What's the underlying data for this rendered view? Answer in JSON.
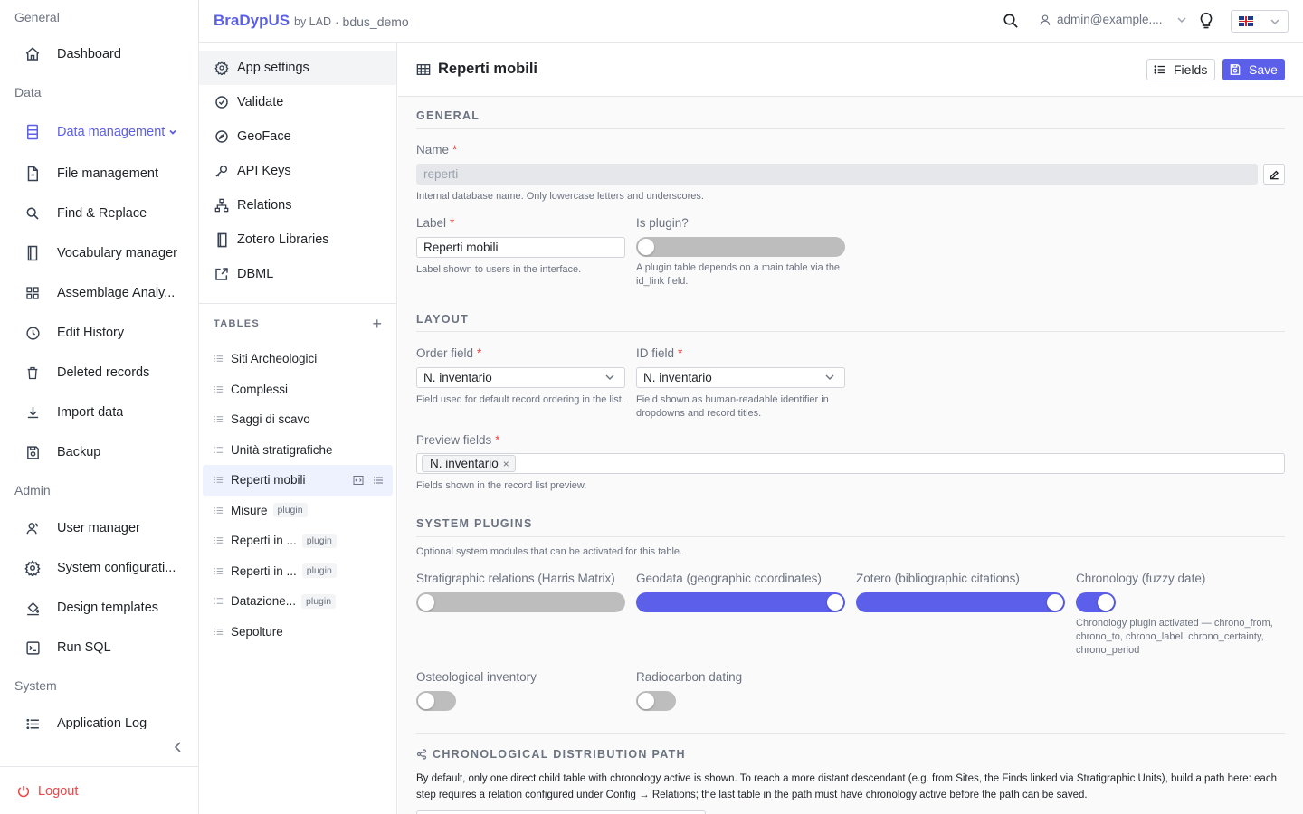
{
  "sidebar": {
    "groups": {
      "general": "General",
      "data": "Data",
      "admin": "Admin",
      "system": "System"
    },
    "items": {
      "dashboard": "Dashboard",
      "data_management": "Data management",
      "file_management": "File management",
      "find_replace": "Find & Replace",
      "vocabulary": "Vocabulary manager",
      "assemblage": "Assemblage Analy...",
      "edit_history": "Edit History",
      "deleted_records": "Deleted records",
      "import_data": "Import data",
      "backup": "Backup",
      "user_manager": "User manager",
      "system_config": "System configurati...",
      "design_templates": "Design templates",
      "run_sql": "Run SQL",
      "app_log": "Application Log"
    },
    "logout": "Logout"
  },
  "topbar": {
    "brand": "BraDypUS",
    "byline": "by LAD",
    "project": "· bdus_demo",
    "user": "admin@example....",
    "language_flag": "uk-flag-icon"
  },
  "settings_menu": {
    "items": [
      "App settings",
      "Validate",
      "GeoFace",
      "API Keys",
      "Relations",
      "Zotero Libraries",
      "DBML"
    ]
  },
  "tables": {
    "header": "TABLES",
    "rows": [
      {
        "name": "Siti Archeologici",
        "badge": ""
      },
      {
        "name": "Complessi",
        "badge": ""
      },
      {
        "name": "Saggi di scavo",
        "badge": ""
      },
      {
        "name": "Unità stratigrafiche",
        "badge": ""
      },
      {
        "name": "Reperti mobili",
        "badge": ""
      },
      {
        "name": "Misure",
        "badge": "plugin"
      },
      {
        "name": "Reperti in ...",
        "badge": "plugin"
      },
      {
        "name": "Reperti in ...",
        "badge": "plugin"
      },
      {
        "name": "Datazione...",
        "badge": "plugin"
      },
      {
        "name": "Sepolture",
        "badge": ""
      }
    ]
  },
  "main": {
    "title": "Reperti mobili",
    "fields_button": "Fields",
    "save_button": "Save",
    "general": {
      "title": "GENERAL",
      "name_label": "Name",
      "name_value": "reperti",
      "name_help": "Internal database name. Only lowercase letters and underscores.",
      "label_label": "Label",
      "label_value": "Reperti mobili",
      "label_help": "Label shown to users in the interface.",
      "plugin_label": "Is plugin?",
      "plugin_on": false,
      "plugin_help": "A plugin table depends on a main table via the id_link field."
    },
    "layout": {
      "title": "LAYOUT",
      "order_label": "Order field",
      "order_value": "N. inventario",
      "order_help": "Field used for default record ordering in the list.",
      "id_label": "ID field",
      "id_value": "N. inventario",
      "id_help": "Field shown as human-readable identifier in dropdowns and record titles.",
      "preview_label": "Preview fields",
      "preview_chip": "N. inventario",
      "preview_help": "Fields shown in the record list preview."
    },
    "plugins": {
      "title": "SYSTEM PLUGINS",
      "desc": "Optional system modules that can be activated for this table.",
      "strat_label": "Stratigraphic relations (Harris Matrix)",
      "strat_on": false,
      "geo_label": "Geodata (geographic coordinates)",
      "geo_on": true,
      "zotero_label": "Zotero (bibliographic citations)",
      "zotero_on": true,
      "chrono_label": "Chronology (fuzzy date)",
      "chrono_on": true,
      "chrono_help": "Chronology plugin activated — chrono_from, chrono_to, chrono_label, chrono_certainty, chrono_period",
      "osteo_label": "Osteological inventory",
      "osteo_on": false,
      "radio_label": "Radiocarbon dating",
      "radio_on": false
    },
    "chrono_path": {
      "title": "CHRONOLOGICAL DISTRIBUTION PATH",
      "desc": "By default, only one direct child table with chronology active is shown. To reach a more distant descendant (e.g. from Sites, the Finds linked via Stratigraphic Units), build a path here: each step requires a relation configured under Config → Relations; the last table in the path must have chronology active before the path can be saved."
    }
  },
  "colors": {
    "accent": "#5b5fe9",
    "danger": "#ef4444",
    "toggle_off": "#bdbdbd"
  }
}
